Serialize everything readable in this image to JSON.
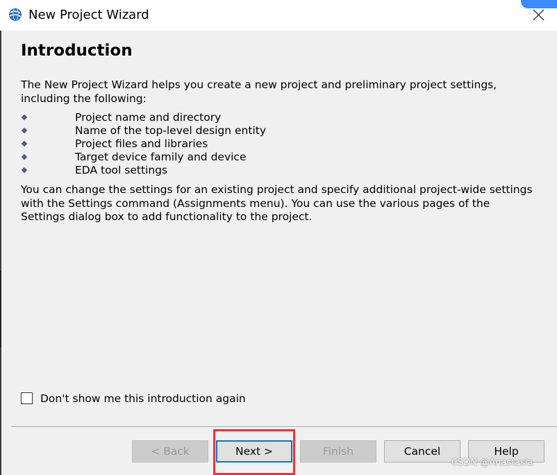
{
  "window": {
    "title": "New Project Wizard",
    "icon": "globe-icon",
    "close_icon": "close-icon"
  },
  "content": {
    "heading": "Introduction",
    "intro": "The New Project Wizard helps you create a new project and preliminary project settings, including the following:",
    "bullets": [
      "Project name and directory",
      "Name of the top-level design entity",
      "Project files and libraries",
      "Target device family and device",
      "EDA tool settings"
    ],
    "closing": "You can change the settings for an existing project and specify additional project-wide settings with the Settings command (Assignments menu). You can use the various pages of the Settings dialog box to add functionality to the project."
  },
  "options": {
    "dont_show_label": "Don't show me this introduction again",
    "dont_show_checked": false
  },
  "buttons": {
    "back": "< Back",
    "next": "Next >",
    "finish": "Finish",
    "cancel": "Cancel",
    "help": "Help"
  },
  "watermark": "CSDN @Anastasia",
  "colors": {
    "highlight": "#ff2d2d",
    "focus": "#0078d7",
    "background": "#f0f0f0"
  }
}
